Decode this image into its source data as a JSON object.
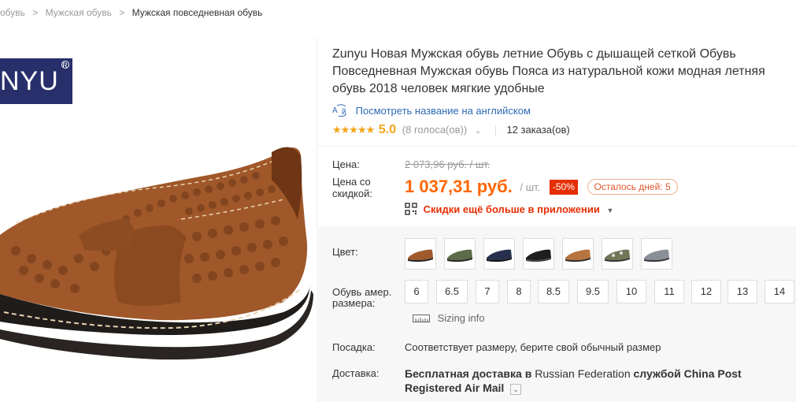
{
  "breadcrumb": {
    "first": "обувь",
    "second": "Мужская обувь",
    "current": "Мужская повседневная обувь",
    "separator": ">"
  },
  "gallery": {
    "brand_logo": "NYU",
    "reg_mark": "R"
  },
  "product": {
    "title": "Zunyu Новая Мужская обувь летние Обувь с дышащей сеткой Обувь Повседневная Мужская обувь Пояса из натуральной кожи модная летняя обувь 2018 человек мягкие удобные",
    "translate_link": "Посмотреть название на английском",
    "stars": "★★★★★",
    "rating": "5.0",
    "votes": "(8 голоса(ов))",
    "orders": "12 заказа(ов)"
  },
  "price": {
    "label_price": "Цена:",
    "original": "2 073,96 руб. / шт.",
    "label_discount_line1": "Цена со",
    "label_discount_line2": "скидкой:",
    "current": "1 037,31 руб.",
    "unit": "/ шт.",
    "discount_badge": "-50%",
    "days_left": "Осталось дней: 5",
    "app_promo": "Скидки ещё больше в приложении"
  },
  "options": {
    "color_label": "Цвет:",
    "size_label_line1": "Обувь амер.",
    "size_label_line2": "размера:",
    "sizes": [
      "6",
      "6.5",
      "7",
      "8",
      "8.5",
      "9.5",
      "10",
      "11",
      "12",
      "13",
      "14"
    ],
    "sizing_info": "Sizing info",
    "fit_label": "Посадка:",
    "fit_value": "Соответствует размеру, берите свой обычный размер",
    "delivery_label": "Доставка:",
    "delivery_bold1": "Бесплатная доставка в",
    "delivery_normal": "Russian Federation",
    "delivery_bold2": "службой China Post Registered Air Mail"
  },
  "colors": {
    "accent_price": "#ff6600",
    "discount_badge": "#e62e04",
    "link": "#2d6ab6",
    "stars": "#f0a418"
  }
}
